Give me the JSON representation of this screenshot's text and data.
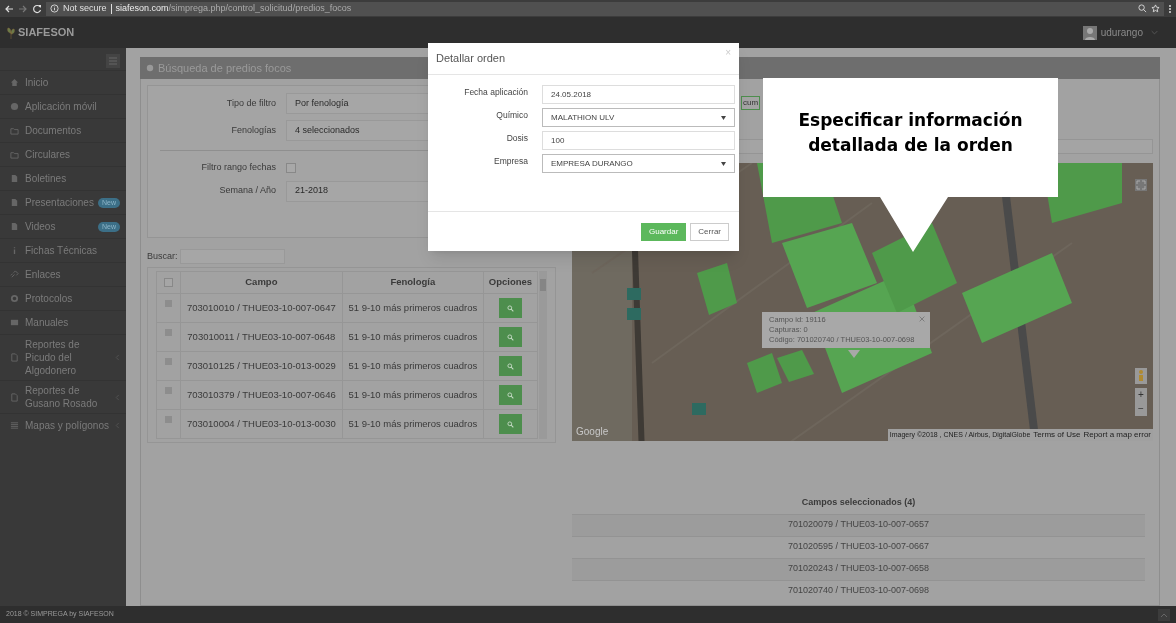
{
  "browser": {
    "security": "Not secure",
    "url_host": "siafeson.com",
    "url_path": "/simprega.php/control_solicitud/predios_focos"
  },
  "header": {
    "brand": "SIAFESON",
    "user": "udurango"
  },
  "sidebar": {
    "items": [
      {
        "label": "Inicio",
        "has_children": false
      },
      {
        "label": "Aplicación móvil",
        "has_children": false
      },
      {
        "label": "Documentos",
        "has_children": false
      },
      {
        "label": "Circulares",
        "has_children": false
      },
      {
        "label": "Boletines",
        "has_children": false
      },
      {
        "label": "Presentaciones",
        "badge": "New",
        "has_children": false
      },
      {
        "label": "Videos",
        "badge": "New",
        "has_children": false
      },
      {
        "label": "Fichas Técnicas",
        "has_children": false
      },
      {
        "label": "Enlaces",
        "has_children": false
      },
      {
        "label": "Protocolos",
        "has_children": false
      },
      {
        "label": "Manuales",
        "has_children": false
      },
      {
        "label": "Reportes de Picudo del Algodonero",
        "has_children": true
      },
      {
        "label": "Reportes de Gusano Rosado",
        "has_children": true
      },
      {
        "label": "Mapas y polígonos",
        "has_children": true
      }
    ]
  },
  "panel": {
    "title": "Búsqueda de predios focos",
    "filters": [
      {
        "kind": "select",
        "label": "Tipo de filtro",
        "value": "Por fenología"
      },
      {
        "kind": "select",
        "label": "Fenologías",
        "value": "4 seleccionados"
      },
      {
        "kind": "checkbox",
        "label": "Filtro rango fechas",
        "checked": false
      },
      {
        "kind": "input",
        "label": "Semana / Año",
        "value": "21-2018"
      }
    ],
    "search_label": "Buscar:",
    "table": {
      "all_selected": false,
      "columns": [
        "Campo",
        "Fenología",
        "Opciones"
      ],
      "rows": [
        {
          "selected": false,
          "campo": "703010010 / THUE03-10-007-0647",
          "fenologia": "51 9-10 más primeros cuadros"
        },
        {
          "selected": false,
          "campo": "703010011 / THUE03-10-007-0648",
          "fenologia": "51 9-10 más primeros cuadros"
        },
        {
          "selected": false,
          "campo": "703010125 / THUE03-10-013-0029",
          "fenologia": "51 9-10 más primeros cuadros"
        },
        {
          "selected": false,
          "campo": "703010379 / THUE03-10-007-0646",
          "fenologia": "51 9-10 más primeros cuadros"
        },
        {
          "selected": false,
          "campo": "703010004 / THUE03-10-013-0030",
          "fenologia": "51 9-10 más primeros cuadros"
        }
      ]
    },
    "partial_field": "cum",
    "map": {
      "popup": [
        "Campo id: 19116",
        "Capturas: 0",
        "Código: 701020740 / THUE03-10-007-0698"
      ],
      "logo": "Google",
      "attribution": "Imagery ©2018 , CNES / Airbus, DigitalGlobe",
      "terms": "Terms of Use",
      "report": "Report a map error",
      "zoom_in": "+",
      "zoom_out": "−"
    },
    "selected_fields": {
      "title": "Campos seleccionados (4)",
      "items": [
        "701020079 / THUE03-10-007-0657",
        "701020595 / THUE03-10-007-0667",
        "701020243 / THUE03-10-007-0658",
        "701020740 / THUE03-10-007-0698"
      ]
    }
  },
  "modal": {
    "title": "Detallar orden",
    "close": "×",
    "fields": [
      {
        "kind": "input",
        "label": "Fecha aplicación",
        "value": "24.05.2018"
      },
      {
        "kind": "select",
        "label": "Químico",
        "value": "MALATHION ULV"
      },
      {
        "kind": "input",
        "label": "Dosis",
        "value": "100"
      },
      {
        "kind": "select",
        "label": "Empresa",
        "value": "EMPRESA DURANGO"
      }
    ],
    "buttons": [
      {
        "kind": "primary",
        "label": "Guardar"
      },
      {
        "kind": "default",
        "label": "Cerrar"
      }
    ]
  },
  "callout": "Especificar información detallada de la orden",
  "footer": "2018 © SIMPREGA by SIAFESON"
}
